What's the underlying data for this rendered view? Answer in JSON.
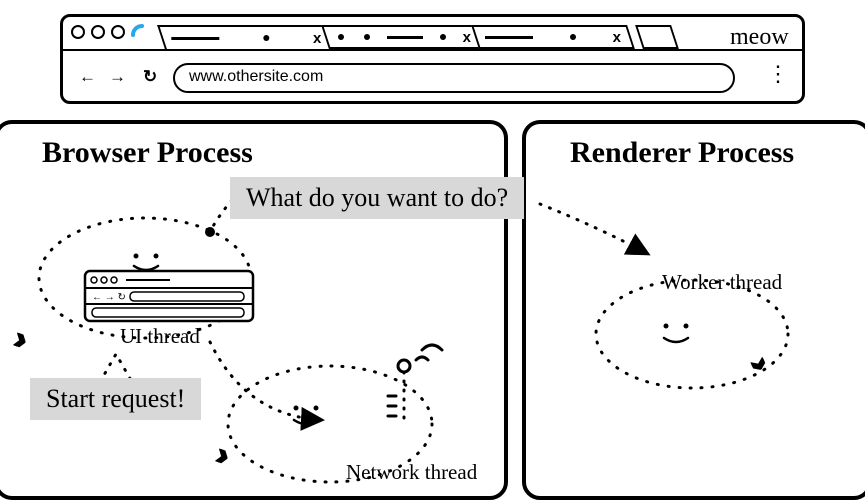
{
  "browser": {
    "url": "www.othersite.com",
    "tab_close_glyph": "x",
    "window_label": "meow",
    "nav": {
      "back": "←",
      "forward": "→",
      "reload": "↻",
      "menu": "⋮"
    }
  },
  "diagram": {
    "browser_process": {
      "title": "Browser Process",
      "ui_thread_label": "UI thread",
      "network_thread_label": "Network thread",
      "question_bubble": "What do you want to do?",
      "start_request_bubble": "Start request!"
    },
    "renderer_process": {
      "title": "Renderer Process",
      "worker_thread_label": "Worker thread"
    }
  }
}
